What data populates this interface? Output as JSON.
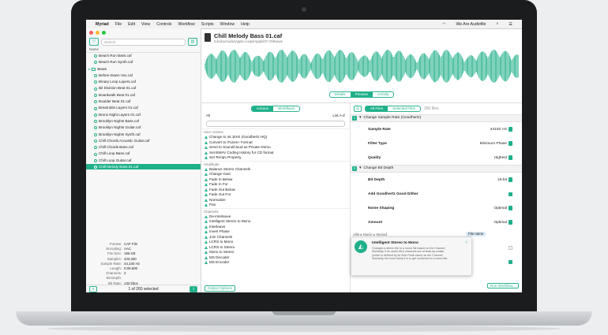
{
  "menubar": {
    "app": "Myriad",
    "items": [
      "File",
      "Edit",
      "View",
      "Controls",
      "Workflow",
      "Scripts",
      "Window",
      "Help"
    ],
    "right": "We Are Audiofile"
  },
  "sidebar": {
    "search_placeholder": "Search",
    "name_header": "Name",
    "rows": [
      {
        "label": "Beach Run Bass.caf",
        "type": "file"
      },
      {
        "label": "Beach Run Synth.caf",
        "type": "file"
      },
      {
        "label": "Beats",
        "type": "group"
      },
      {
        "label": "Before Dawn Vox.caf",
        "type": "file"
      },
      {
        "label": "Binary Loop Layers.caf",
        "type": "file"
      },
      {
        "label": "Bit Division Beat 01.caf",
        "type": "file"
      },
      {
        "label": "Boardwalk Beat 01.caf",
        "type": "file"
      },
      {
        "label": "Boulder Beat 01.caf",
        "type": "file"
      },
      {
        "label": "Break Bits Layers 01.caf",
        "type": "file"
      },
      {
        "label": "Bronx Night Layers 01.caf",
        "type": "file"
      },
      {
        "label": "Brooklyn Nights Bass.caf",
        "type": "file"
      },
      {
        "label": "Brooklyn Nights Guitar.caf",
        "type": "file"
      },
      {
        "label": "Brooklyn Nights Synth.caf",
        "type": "file"
      },
      {
        "label": "Chill Chords Acoustic Guitar.caf",
        "type": "file"
      },
      {
        "label": "Chill Chords Bass.caf",
        "type": "file"
      },
      {
        "label": "Chill Loop Bass.caf",
        "type": "file"
      },
      {
        "label": "Chill Loop Guitar.caf",
        "type": "file"
      },
      {
        "label": "Chill Melody Bass 01.caf",
        "type": "file",
        "selected": true
      },
      {
        "label": "Chill Melody Guitar Chords.caf",
        "type": "file"
      },
      {
        "label": "Chill Melody Lead Guitar.caf",
        "type": "file"
      },
      {
        "label": "Chill Melody Synth 01.caf",
        "type": "file"
      },
      {
        "label": "Chime Chord Layers 01.caf",
        "type": "file"
      },
      {
        "label": "Cinema Interlude Layers.caf",
        "type": "file"
      },
      {
        "label": "Classic Drum Machine 01.caf",
        "type": "file"
      },
      {
        "label": "Classical",
        "type": "group"
      }
    ],
    "meta": [
      {
        "k": "Format:",
        "v": "CAF File"
      },
      {
        "k": "Encoding:",
        "v": "AAC"
      },
      {
        "k": "File Size:",
        "v": "196 KB"
      },
      {
        "k": "Samples:",
        "v": "423,360"
      },
      {
        "k": "Sample Rate:",
        "v": "44,100 Hz"
      },
      {
        "k": "Length:",
        "v": "0:09.600"
      },
      {
        "k": "Channels:",
        "v": "2"
      },
      {
        "k": "Bit Depth:",
        "v": ""
      },
      {
        "k": "Bit Rate:",
        "v": "132 kbps"
      }
    ],
    "selection_status": "1 of 260 selected"
  },
  "header": {
    "title": "Chill Melody Bass 01.caf",
    "path": "/Library/Audio/Apple Loops/Apple/07 Chillwave"
  },
  "view_tabs": [
    {
      "label": "Details",
      "on": false
    },
    {
      "label": "Preview",
      "on": true
    },
    {
      "label": "Activity",
      "on": false
    }
  ],
  "actions": {
    "tabs": [
      {
        "label": "Actions",
        "on": true
      },
      {
        "label": "Workflows",
        "on": false
      }
    ],
    "filter_left": "All",
    "filter_right": "List A-Z",
    "sections": [
      {
        "title": "User Actions",
        "items": [
          "Change to 44.1kHz (Goodhertz HQ)",
          "Convert to iTunes+ Format",
          "Send to SoundCloud as Private Demo",
          "Set BWAV Coding History for CD format",
          "Set Tempo Property"
        ]
      },
      {
        "title": "Amplitude",
        "items": [
          "Balance Stereo Channels",
          "Change Gain",
          "Fade In Below",
          "Fade In For",
          "Fade Out Below",
          "Fade Out For",
          "Normalize",
          "Pan"
        ]
      },
      {
        "title": "Channels",
        "items": [
          "De-interleave",
          "Intelligent Stereo to Mono",
          "Interleave",
          "Invert Phase",
          "Join Channels",
          "LCRS to Mono",
          "LCRS to Stereo",
          "Mono to Stereo",
          "MS Decoder",
          "MS Encoder"
        ]
      }
    ],
    "output_options": "Output Options"
  },
  "settings": {
    "tabs": [
      {
        "label": "All Files",
        "on": true
      },
      {
        "label": "Selected Files",
        "on": false
      }
    ],
    "file_count": "260 files",
    "blocks": [
      {
        "num": "1",
        "title": "Change Sample Rate (Goodhertz)",
        "rows": [
          {
            "label": "Sample Rate",
            "value": "44100",
            "unit": "Hz"
          },
          {
            "label": "Filter Type",
            "value": "Minimum Phase"
          },
          {
            "label": "Quality",
            "value": "Highest"
          }
        ]
      },
      {
        "num": "2",
        "title": "Change Bit Depth",
        "rows": [
          {
            "label": "Bit Depth",
            "value": "16-bit"
          },
          {
            "label": "Add Goodhertz Good Dither",
            "value": "",
            "check": true
          },
          {
            "label": "Noise Shaping",
            "value": "Optimal"
          },
          {
            "label": "Amount",
            "value": "Optimal"
          }
        ]
      }
    ],
    "lower_rows": [
      {
        "label": "Preserve Hierarchy",
        "check": false
      },
      {
        "label": "Add Processed Files to List",
        "check": true
      }
    ],
    "path_crumbs": "ofile ▸ Music ▸ Myriad",
    "file_name_token": "File name",
    "run_button": "Run Workflow..."
  },
  "tooltip": {
    "title": "Intelligent Stereo to Mono",
    "body": "Changes a stereo file to a mono file based on the Channel Similarity. If an audio file's channels are at least as similar (which is defined by its Side Peak value) as the Channel Similarity, the more likely it is to get converted to a mono file."
  },
  "colors": {
    "accent": "#1fb08a",
    "waveform": "#2cb38f"
  }
}
